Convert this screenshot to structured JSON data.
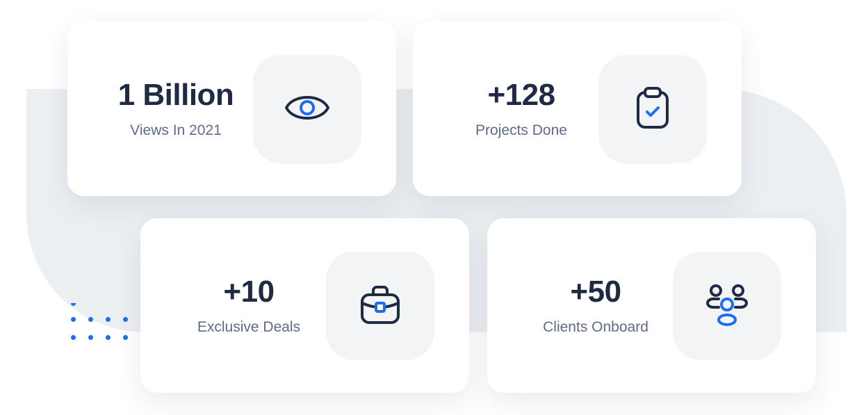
{
  "stats": [
    {
      "value": "1 Billion",
      "label": "Views In 2021",
      "icon": "eye-icon"
    },
    {
      "value": "+128",
      "label": "Projects Done",
      "icon": "clipboard-check-icon"
    },
    {
      "value": "+10",
      "label": "Exclusive Deals",
      "icon": "briefcase-icon"
    },
    {
      "value": "+50",
      "label": "Clients Onboard",
      "icon": "users-group-icon"
    }
  ],
  "colors": {
    "accent": "#1d6df2",
    "text_dark": "#1f2a44",
    "text_muted": "#5d6b86",
    "icon_box": "#f2f4f6",
    "backdrop": "#eceff2"
  }
}
